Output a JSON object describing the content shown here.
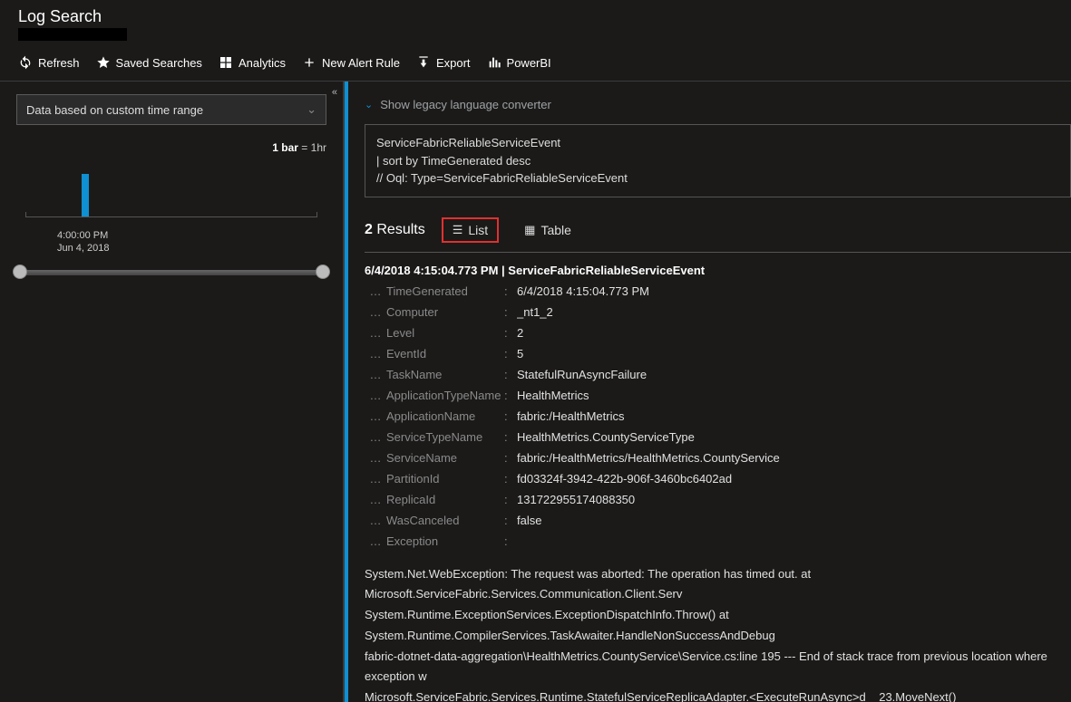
{
  "header": {
    "title": "Log Search"
  },
  "toolbar": {
    "refresh": "Refresh",
    "saved": "Saved Searches",
    "analytics": "Analytics",
    "newAlert": "New Alert Rule",
    "export": "Export",
    "powerbi": "PowerBI"
  },
  "left": {
    "timeRangeLabel": "Data based on custom time range",
    "barLegendPrefix": "1 bar",
    "barLegendSuffix": " = 1hr",
    "barTime": "4:00:00 PM",
    "barDate": "Jun 4, 2018"
  },
  "right": {
    "legacyLink": "Show legacy language converter",
    "queryLines": [
      "ServiceFabricReliableServiceEvent",
      "| sort by TimeGenerated desc",
      "// Oql: Type=ServiceFabricReliableServiceEvent"
    ],
    "resultsCount": "2",
    "resultsLabel": "Results",
    "listLabel": "List",
    "tableLabel": "Table",
    "resultHeader": "6/4/2018 4:15:04.773 PM | ServiceFabricReliableServiceEvent",
    "rows": [
      {
        "key": "TimeGenerated",
        "val": "6/4/2018 4:15:04.773 PM"
      },
      {
        "key": "Computer",
        "val": "_nt1_2"
      },
      {
        "key": "Level",
        "val": "2"
      },
      {
        "key": "EventId",
        "val": "5"
      },
      {
        "key": "TaskName",
        "val": "StatefulRunAsyncFailure"
      },
      {
        "key": "ApplicationTypeName",
        "val": "HealthMetrics"
      },
      {
        "key": "ApplicationName",
        "val": "fabric:/HealthMetrics"
      },
      {
        "key": "ServiceTypeName",
        "val": "HealthMetrics.CountyServiceType"
      },
      {
        "key": "ServiceName",
        "val": "fabric:/HealthMetrics/HealthMetrics.CountyService"
      },
      {
        "key": "PartitionId",
        "val": "fd03324f-3942-422b-906f-3460bc6402ad"
      },
      {
        "key": "ReplicaId",
        "val": "131722955174088350"
      },
      {
        "key": "WasCanceled",
        "val": "false"
      },
      {
        "key": "Exception",
        "val": ""
      }
    ],
    "exceptionLines": [
      "System.Net.WebException: The request was aborted: The operation has timed out. at Microsoft.ServiceFabric.Services.Communication.Client.Serv",
      "System.Runtime.ExceptionServices.ExceptionDispatchInfo.Throw() at System.Runtime.CompilerServices.TaskAwaiter.HandleNonSuccessAndDebug",
      "fabric-dotnet-data-aggregation\\HealthMetrics.CountyService\\Service.cs:line 195 --- End of stack trace from previous location where exception w",
      "Microsoft.ServiceFabric.Services.Runtime.StatefulServiceReplicaAdapter.<ExecuteRunAsync>d__23.MoveNext()"
    ]
  },
  "chart_data": {
    "type": "bar",
    "title": "",
    "categories": [
      "4:00:00 PM Jun 4, 2018"
    ],
    "values": [
      2
    ],
    "xlabel": "",
    "ylabel": "",
    "note": "1 bar = 1hr"
  }
}
